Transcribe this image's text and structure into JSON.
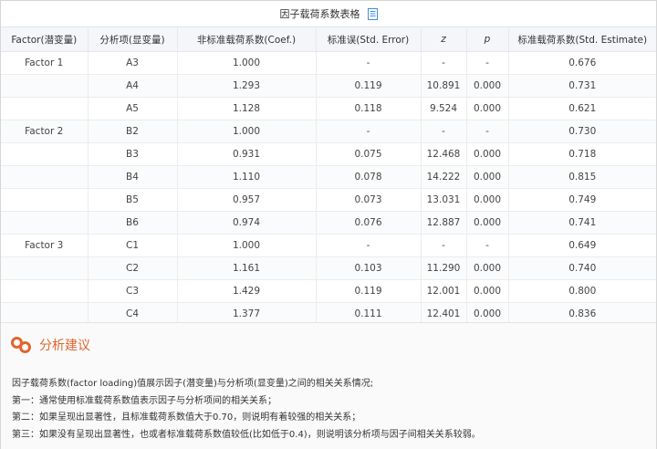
{
  "title": "因子载荷系数表格",
  "headers": [
    "Factor(潜变量)",
    "分析项(显变量)",
    "非标准载荷系数(Coef.)",
    "标准误(Std. Error)",
    "z",
    "p",
    "标准载荷系数(Std. Estimate)"
  ],
  "rows": [
    [
      "Factor 1",
      "A3",
      "1.000",
      "-",
      "-",
      "-",
      "0.676"
    ],
    [
      "",
      "A4",
      "1.293",
      "0.119",
      "10.891",
      "0.000",
      "0.731"
    ],
    [
      "",
      "A5",
      "1.128",
      "0.118",
      "9.524",
      "0.000",
      "0.621"
    ],
    [
      "Factor 2",
      "B2",
      "1.000",
      "-",
      "-",
      "-",
      "0.730"
    ],
    [
      "",
      "B3",
      "0.931",
      "0.075",
      "12.468",
      "0.000",
      "0.718"
    ],
    [
      "",
      "B4",
      "1.110",
      "0.078",
      "14.222",
      "0.000",
      "0.815"
    ],
    [
      "",
      "B5",
      "0.957",
      "0.073",
      "13.031",
      "0.000",
      "0.749"
    ],
    [
      "",
      "B6",
      "0.974",
      "0.076",
      "12.887",
      "0.000",
      "0.741"
    ],
    [
      "Factor 3",
      "C1",
      "1.000",
      "-",
      "-",
      "-",
      "0.649"
    ],
    [
      "",
      "C2",
      "1.161",
      "0.103",
      "11.290",
      "0.000",
      "0.740"
    ],
    [
      "",
      "C3",
      "1.429",
      "0.119",
      "12.001",
      "0.000",
      "0.800"
    ],
    [
      "",
      "C4",
      "1.377",
      "0.111",
      "12.401",
      "0.000",
      "0.836"
    ]
  ],
  "advice": {
    "icon": "link-icon",
    "title": "分析建议",
    "lines": [
      "因子载荷系数(factor loading)值展示因子(潜变量)与分析项(显变量)之间的相关关系情况;",
      "第一：通常使用标准载荷系数值表示因子与分析项间的相关关系；",
      "第二：如果呈现出显著性，且标准载荷系数值大于0.70，则说明有着较强的相关关系；",
      "第三：如果没有呈现出显著性，也或者标准载荷系数值较低(比如低于0.4)，则说明该分析项与因子间相关关系较弱。"
    ]
  },
  "colors": {
    "accent": "#e0662f",
    "icon_blue": "#3d8ee0"
  }
}
